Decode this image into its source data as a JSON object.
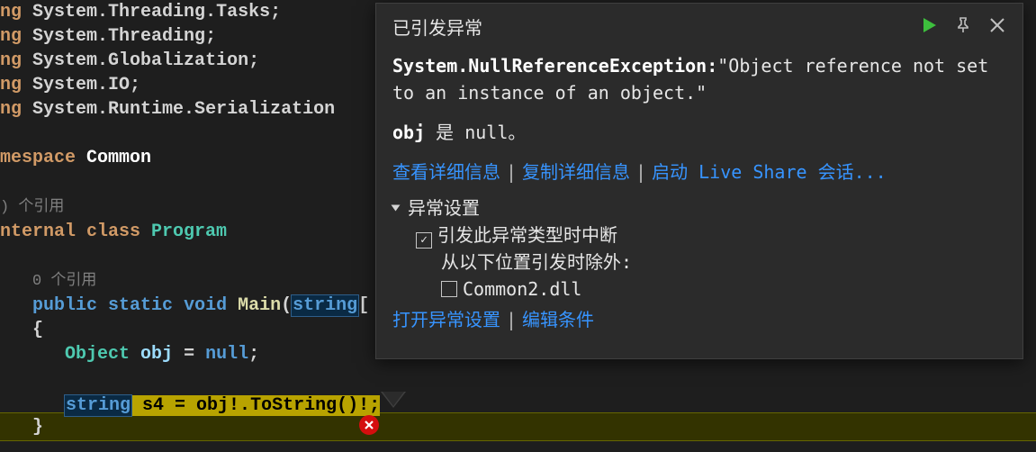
{
  "code": {
    "using_lines": [
      {
        "kw": "ng",
        "ns": "System.Threading.Tasks;"
      },
      {
        "kw": "ng",
        "ns": "System.Threading;"
      },
      {
        "kw": "ng",
        "ns": "System.Globalization;"
      },
      {
        "kw": "ng",
        "ns": "System.IO;"
      },
      {
        "kw": "ng",
        "ns": "System.Runtime.Serialization"
      }
    ],
    "namespace_kw": "mespace",
    "namespace_name": "Common",
    "refcount_class": ") 个引用",
    "class_kw": "nternal class",
    "class_name": "Program",
    "refcount_method": "0 个引用",
    "method_kw_public": "public",
    "method_kw_static": "static",
    "method_kw_void": "void",
    "method_name": "Main",
    "method_param_type": "string",
    "brace_open": "{",
    "obj_type": "Object",
    "obj_name": "obj",
    "eq": " = ",
    "null": "null",
    "semi": ";",
    "hl_string": "string",
    "hl_s4": " s4 = obj!.",
    "hl_tostring": "ToString",
    "hl_tail": "()!;"
  },
  "tooltip": {
    "title": "已引发异常",
    "exception_type": "System.NullReferenceException:",
    "exception_msg": "\"Object reference not set to an instance of an object.\"",
    "obj_label": "obj",
    "obj_is": " 是 null。",
    "link_view": "查看详细信息",
    "link_copy": "复制详细信息",
    "link_live": "启动 Live Share 会话...",
    "settings_label": "异常设置",
    "chk_break": "引发此异常类型时中断",
    "except_from": "从以下位置引发时除外:",
    "except_item": "Common2.dll",
    "link_open": "打开异常设置",
    "link_edit": "编辑条件"
  }
}
